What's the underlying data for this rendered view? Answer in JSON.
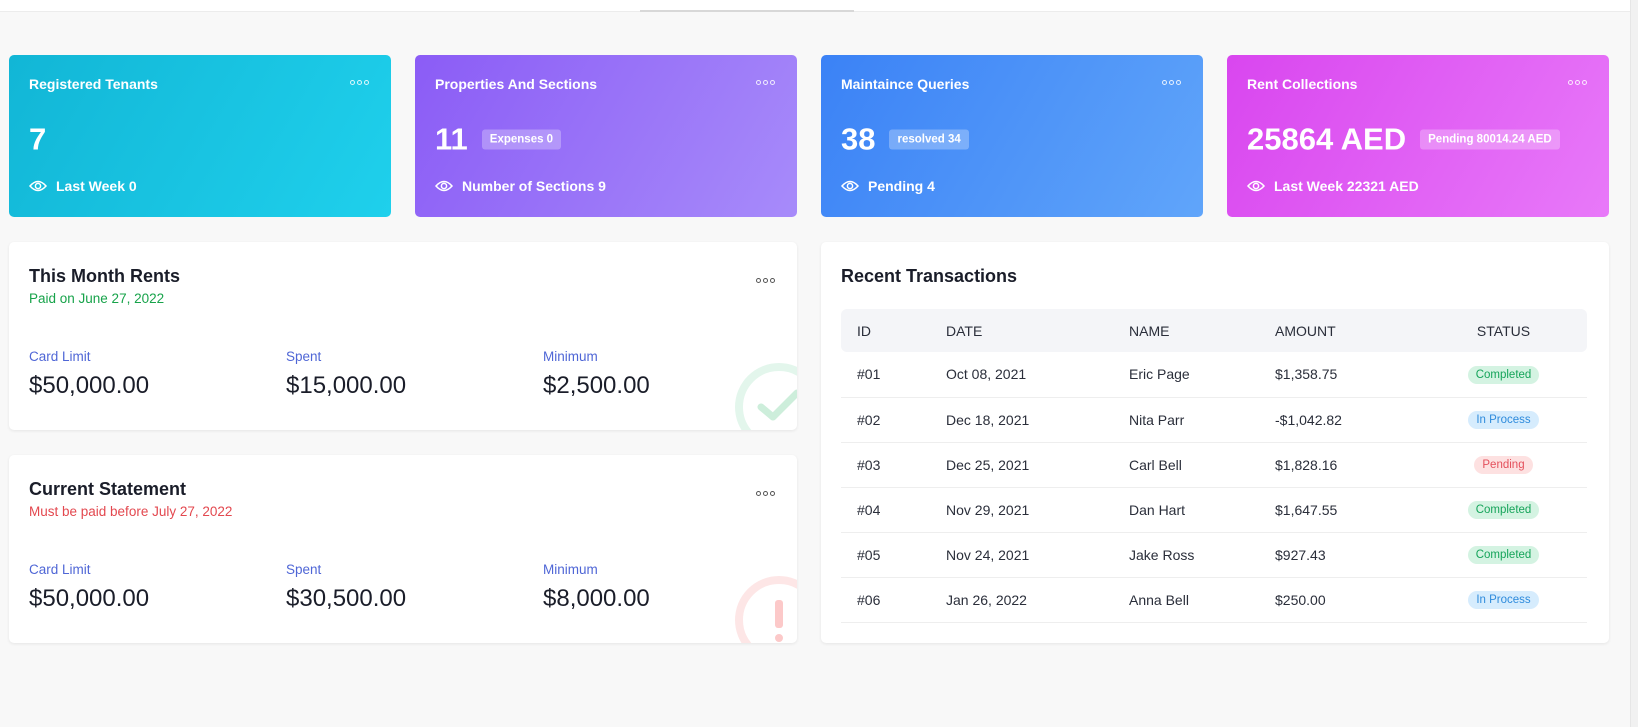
{
  "stat_cards": [
    {
      "title": "Registered Tenants",
      "value": "7",
      "badge": "",
      "footer": "Last Week 0"
    },
    {
      "title": "Properties And Sections",
      "value": "11",
      "badge": "Expenses 0",
      "footer": "Number of Sections 9"
    },
    {
      "title": "Maintaince Queries",
      "value": "38",
      "badge": "resolved 34",
      "footer": "Pending 4"
    },
    {
      "title": "Rent Collections",
      "value": "25864 AED",
      "badge": "Pending 80014.24 AED",
      "footer": "Last Week 22321 AED"
    }
  ],
  "month_rents": {
    "title": "This Month Rents",
    "subtitle": "Paid on June 27, 2022",
    "subtitle_color": "#17a34a",
    "columns": [
      {
        "label": "Card Limit",
        "value": "$50,000.00"
      },
      {
        "label": "Spent",
        "value": "$15,000.00"
      },
      {
        "label": "Minimum",
        "value": "$2,500.00"
      }
    ]
  },
  "statement": {
    "title": "Current Statement",
    "subtitle": "Must be paid before July 27, 2022",
    "subtitle_color": "#e3484f",
    "columns": [
      {
        "label": "Card Limit",
        "value": "$50,000.00"
      },
      {
        "label": "Spent",
        "value": "$30,500.00"
      },
      {
        "label": "Minimum",
        "value": "$8,000.00"
      }
    ]
  },
  "transactions": {
    "title": "Recent Transactions",
    "headers": [
      "ID",
      "DATE",
      "NAME",
      "AMOUNT",
      "STATUS"
    ],
    "rows": [
      {
        "id": "#01",
        "date": "Oct 08, 2021",
        "name": "Eric Page",
        "amount": "$1,358.75",
        "status": "Completed"
      },
      {
        "id": "#02",
        "date": "Dec 18, 2021",
        "name": "Nita Parr",
        "amount": "-$1,042.82",
        "status": "In Process"
      },
      {
        "id": "#03",
        "date": "Dec 25, 2021",
        "name": "Carl Bell",
        "amount": "$1,828.16",
        "status": "Pending"
      },
      {
        "id": "#04",
        "date": "Nov 29, 2021",
        "name": "Dan Hart",
        "amount": "$1,647.55",
        "status": "Completed"
      },
      {
        "id": "#05",
        "date": "Nov 24, 2021",
        "name": "Jake Ross",
        "amount": "$927.43",
        "status": "Completed"
      },
      {
        "id": "#06",
        "date": "Jan 26, 2022",
        "name": "Anna Bell",
        "amount": "$250.00",
        "status": "In Process"
      }
    ]
  },
  "colors": {
    "card_tenants": "#12b6d6",
    "card_properties": "#8b5cf6",
    "card_maintenance": "#3b82f6",
    "card_rent": "#d946ef",
    "status_completed": "#16a45a",
    "status_in_process": "#2e8bdc",
    "status_pending": "#e4505c"
  }
}
